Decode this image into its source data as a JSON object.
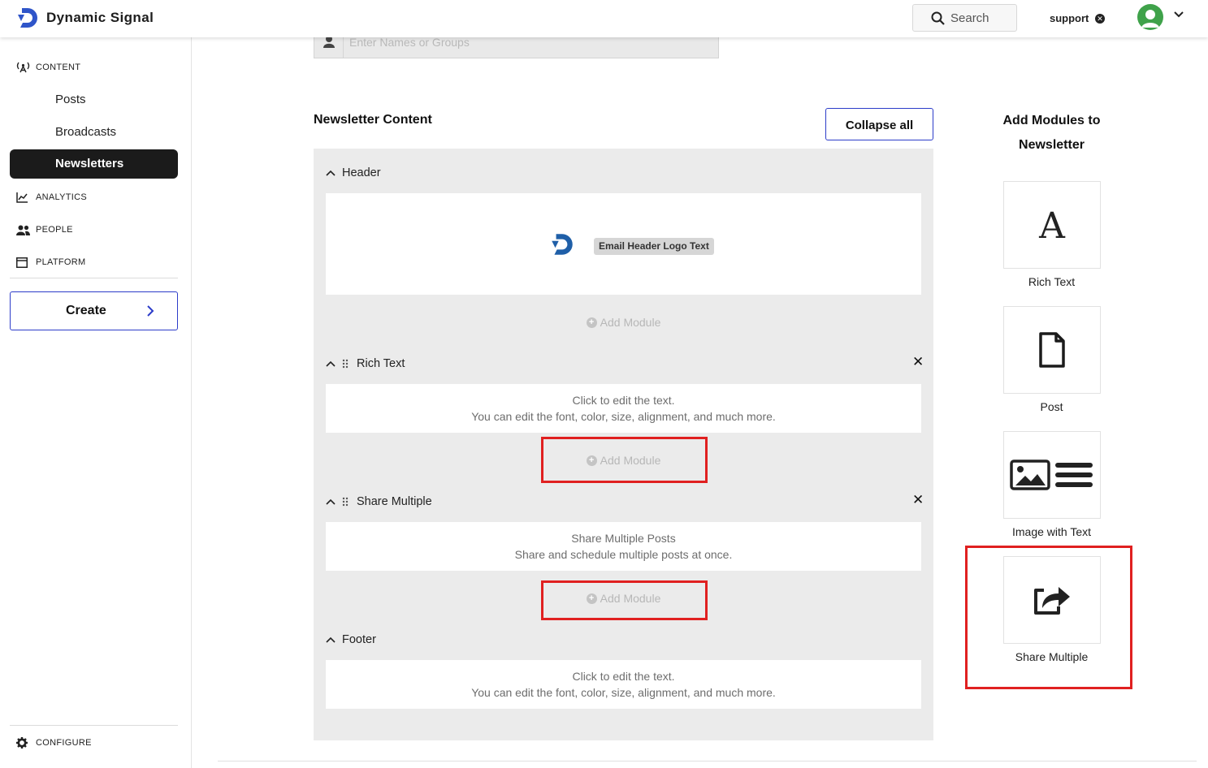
{
  "header": {
    "brand": "Dynamic Signal",
    "search_label": "Search",
    "user_name": "support"
  },
  "sidebar": {
    "sections": [
      {
        "label": "CONTENT",
        "icon": "broadcast-icon"
      },
      {
        "label": "ANALYTICS",
        "icon": "chart-icon"
      },
      {
        "label": "PEOPLE",
        "icon": "people-icon"
      },
      {
        "label": "PLATFORM",
        "icon": "platform-icon"
      }
    ],
    "content_items": [
      "Posts",
      "Broadcasts",
      "Newsletters"
    ],
    "active_item": "Newsletters",
    "create_label": "Create",
    "configure_label": "CONFIGURE"
  },
  "recipients": {
    "placeholder": "Enter Names or Groups"
  },
  "newsletter": {
    "title": "Newsletter Content",
    "collapse_label": "Collapse all",
    "add_module_label": "Add Module",
    "sections": {
      "header": {
        "title": "Header",
        "logo_text": "Email Header Logo Text"
      },
      "rich_text": {
        "title": "Rich Text",
        "line1": "Click to edit the text.",
        "line2": "You can edit the font, color, size, alignment, and much more."
      },
      "share_multiple": {
        "title": "Share Multiple",
        "line1": "Share Multiple Posts",
        "line2": "Share and schedule multiple posts at once."
      },
      "footer": {
        "title": "Footer",
        "line1": "Click to edit the text.",
        "line2": "You can edit the font, color, size, alignment, and much more."
      }
    }
  },
  "modules_panel": {
    "title_line1": "Add Modules to",
    "title_line2": "Newsletter",
    "modules": [
      {
        "label": "Rich Text",
        "icon": "letter-a-icon"
      },
      {
        "label": "Post",
        "icon": "document-icon"
      },
      {
        "label": "Image with Text",
        "icon": "image-with-text-icon"
      },
      {
        "label": "Share Multiple",
        "icon": "share-icon"
      }
    ]
  },
  "colors": {
    "accent": "#2c3cc9",
    "highlight": "#e02020",
    "active_nav": "#1b1b1b",
    "logo_blue": "#1f5fa8"
  }
}
